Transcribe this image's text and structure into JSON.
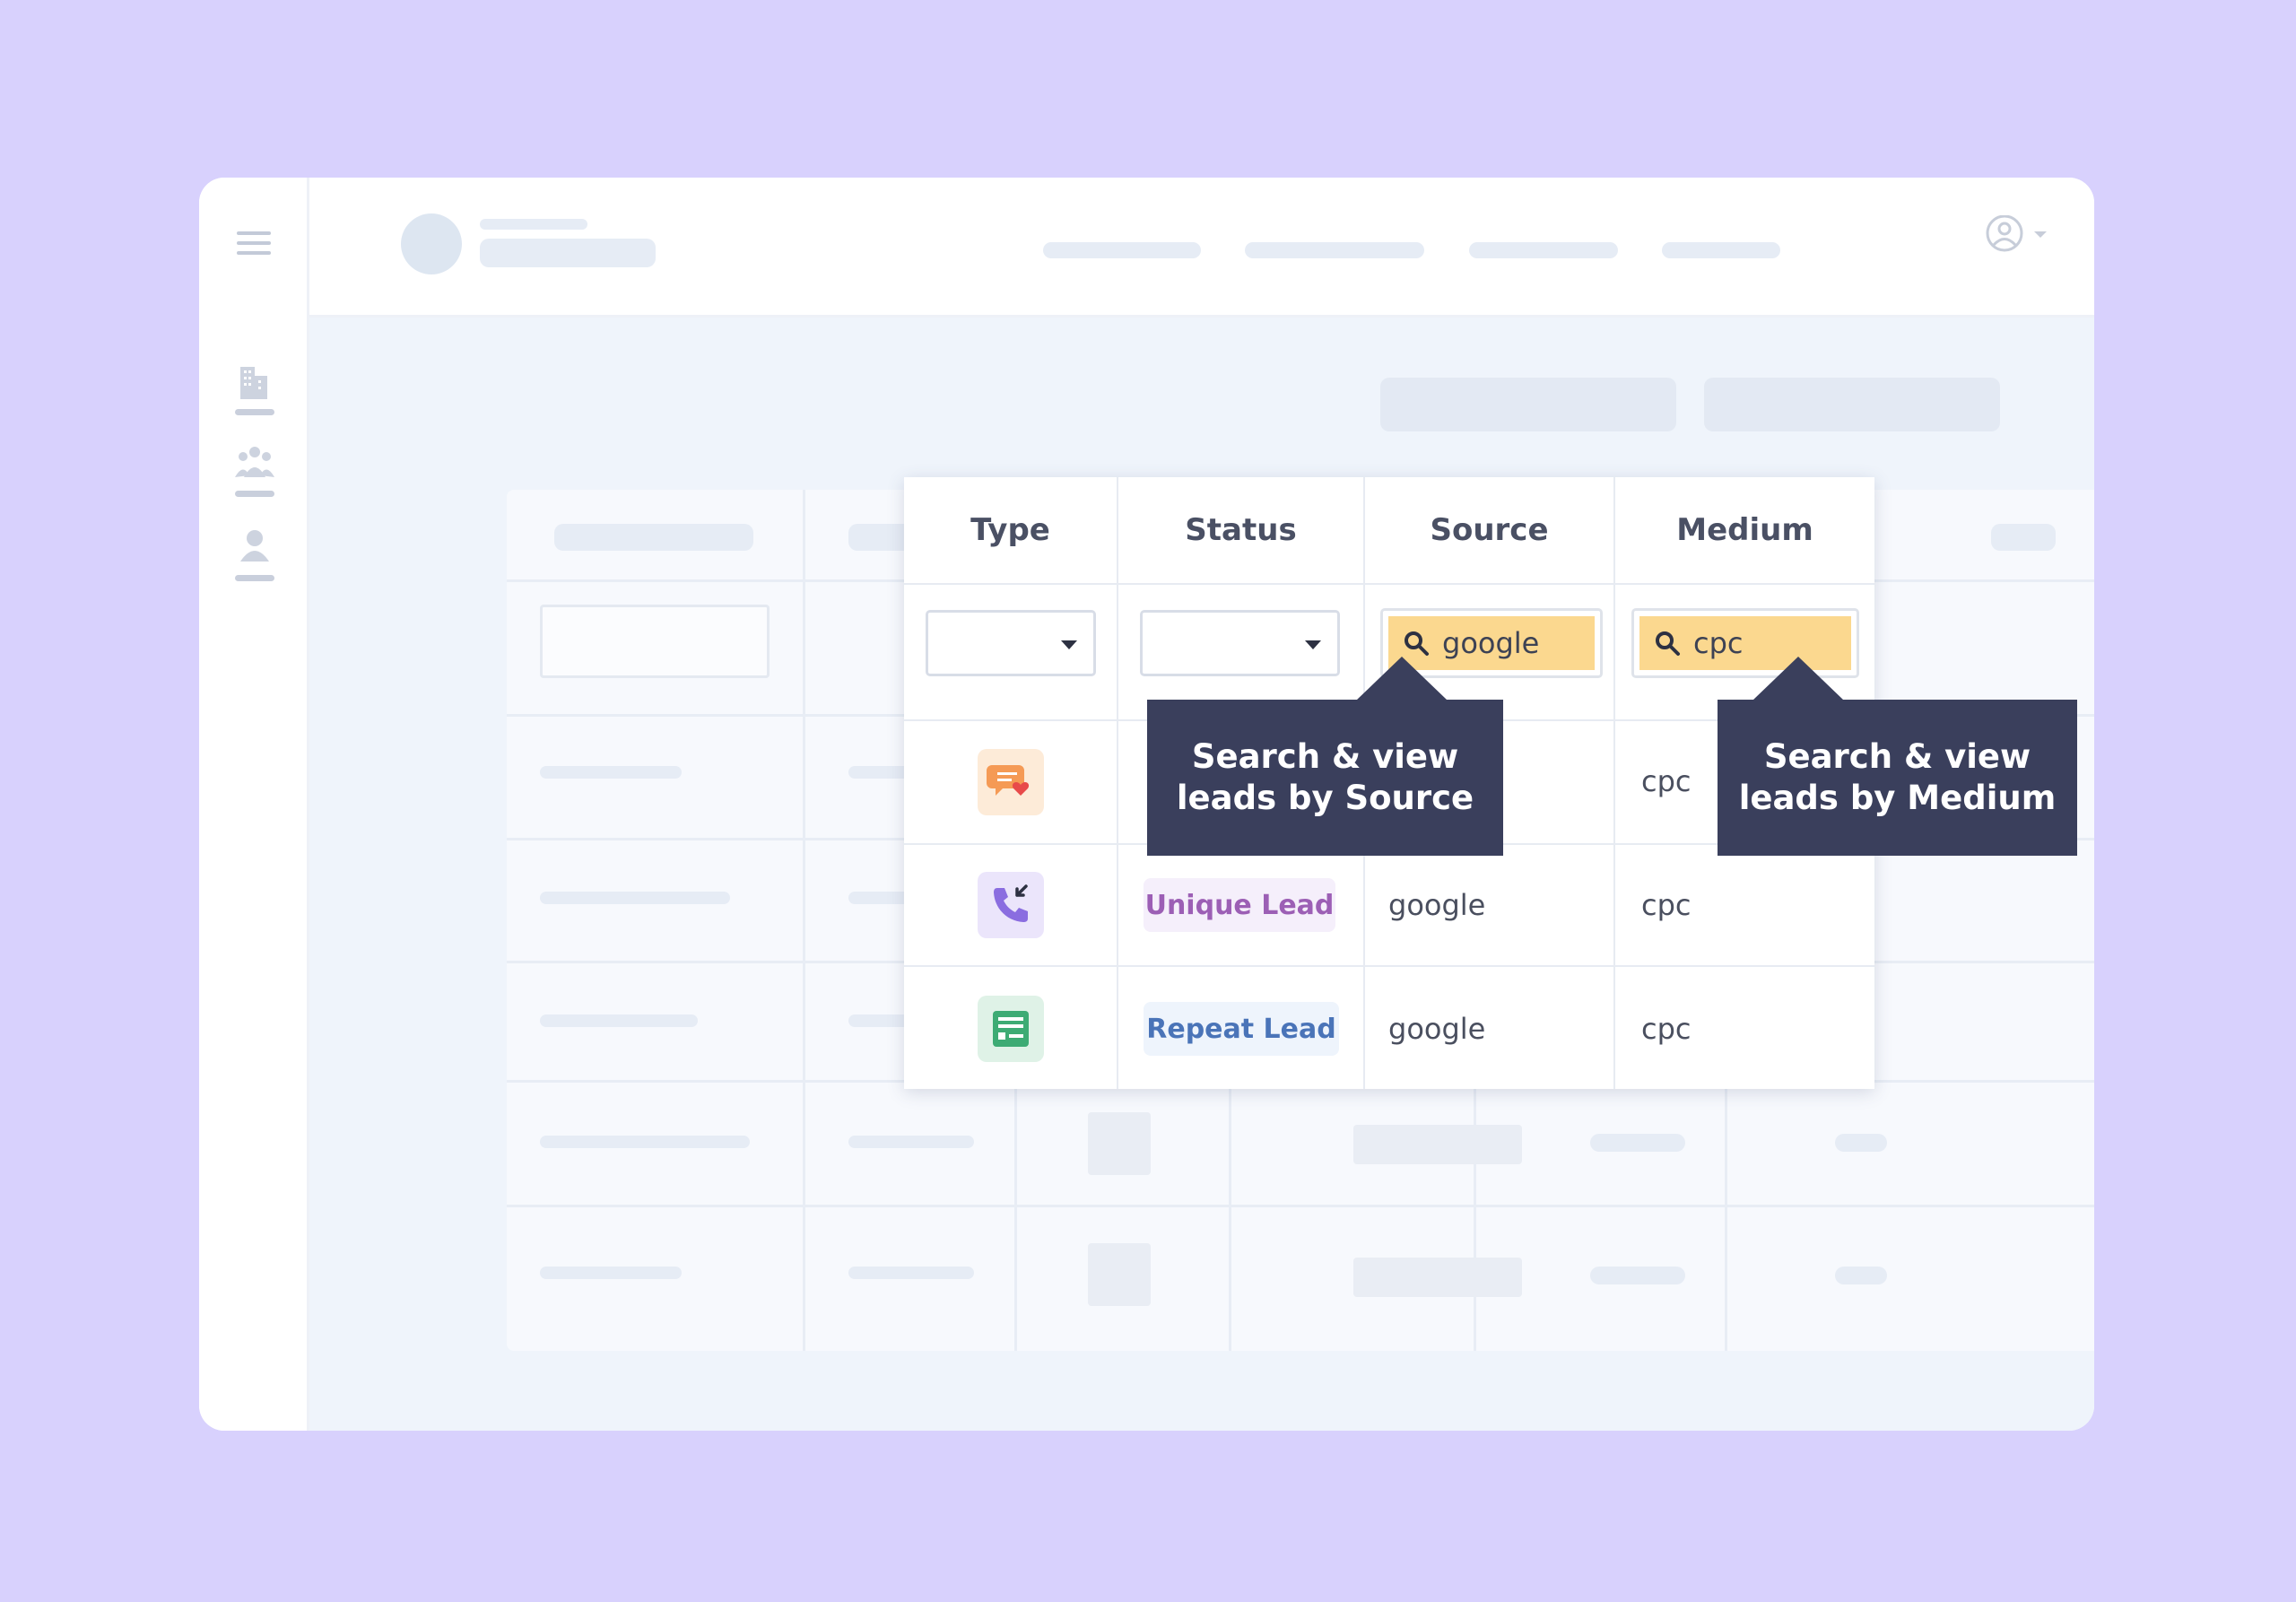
{
  "table": {
    "headers": {
      "type": "Type",
      "status": "Status",
      "source": "Source",
      "medium": "Medium"
    },
    "filters": {
      "type_select": "",
      "status_select": "",
      "source_search": "google",
      "medium_search": "cpc"
    },
    "rows": [
      {
        "type_icon": "chat-icon",
        "status": "",
        "source": "",
        "medium": "cpc"
      },
      {
        "type_icon": "phone-call-icon",
        "status": "Unique Lead",
        "source": "google",
        "medium": "cpc"
      },
      {
        "type_icon": "form-icon",
        "status": "Repeat Lead",
        "source": "google",
        "medium": "cpc"
      }
    ]
  },
  "tooltips": {
    "source": {
      "line1": "Search & view",
      "line2": "leads by Source"
    },
    "medium": {
      "line1": "Search & view",
      "line2": "leads by Medium"
    }
  },
  "colors": {
    "background": "#d8d1fd",
    "tooltip": "#3a3f5c",
    "search_highlight": "#fbd88f",
    "unique_lead_text": "#9c5fb5",
    "repeat_lead_text": "#4a74b8"
  }
}
